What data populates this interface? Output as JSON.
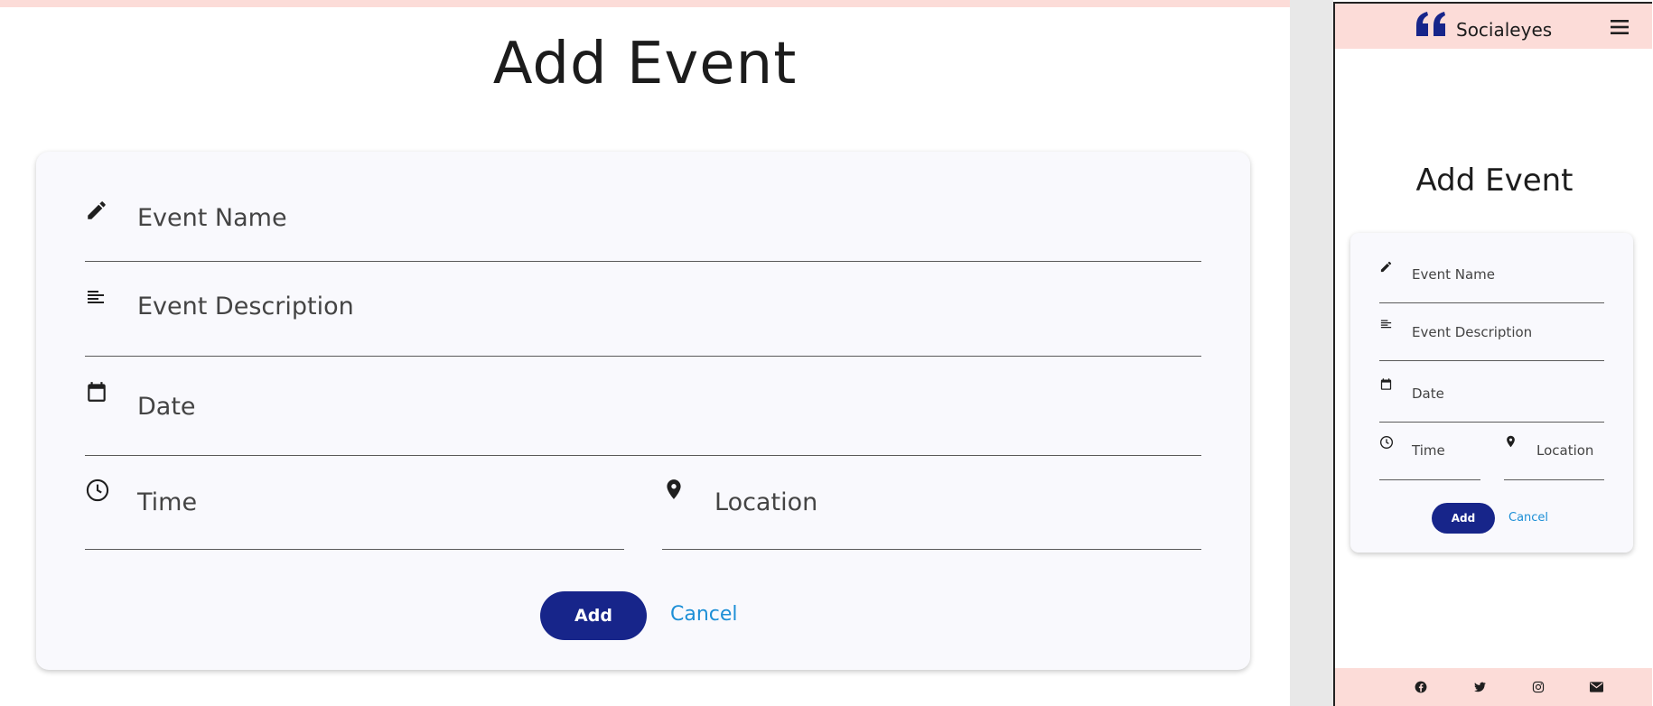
{
  "desktop": {
    "title": "Add Event",
    "fields": {
      "event_name": "Event Name",
      "event_description": "Event Description",
      "date": "Date",
      "time": "Time",
      "location": "Location"
    },
    "add_label": "Add",
    "cancel_label": "Cancel"
  },
  "mobile": {
    "brand": "Socialeyes",
    "menu_icon": "hamburger-menu-icon",
    "title": "Add Event",
    "fields": {
      "event_name": "Event Name",
      "event_description": "Event Description",
      "date": "Date",
      "time": "Time",
      "location": "Location"
    },
    "add_label": "Add",
    "cancel_label": "Cancel",
    "footer_icons": [
      "facebook-icon",
      "twitter-icon",
      "instagram-icon",
      "email-icon"
    ]
  },
  "colors": {
    "header_bg": "#fcdcd8",
    "primary": "#17258a",
    "link": "#1d8fd6",
    "card_bg": "#f9f9fd"
  }
}
